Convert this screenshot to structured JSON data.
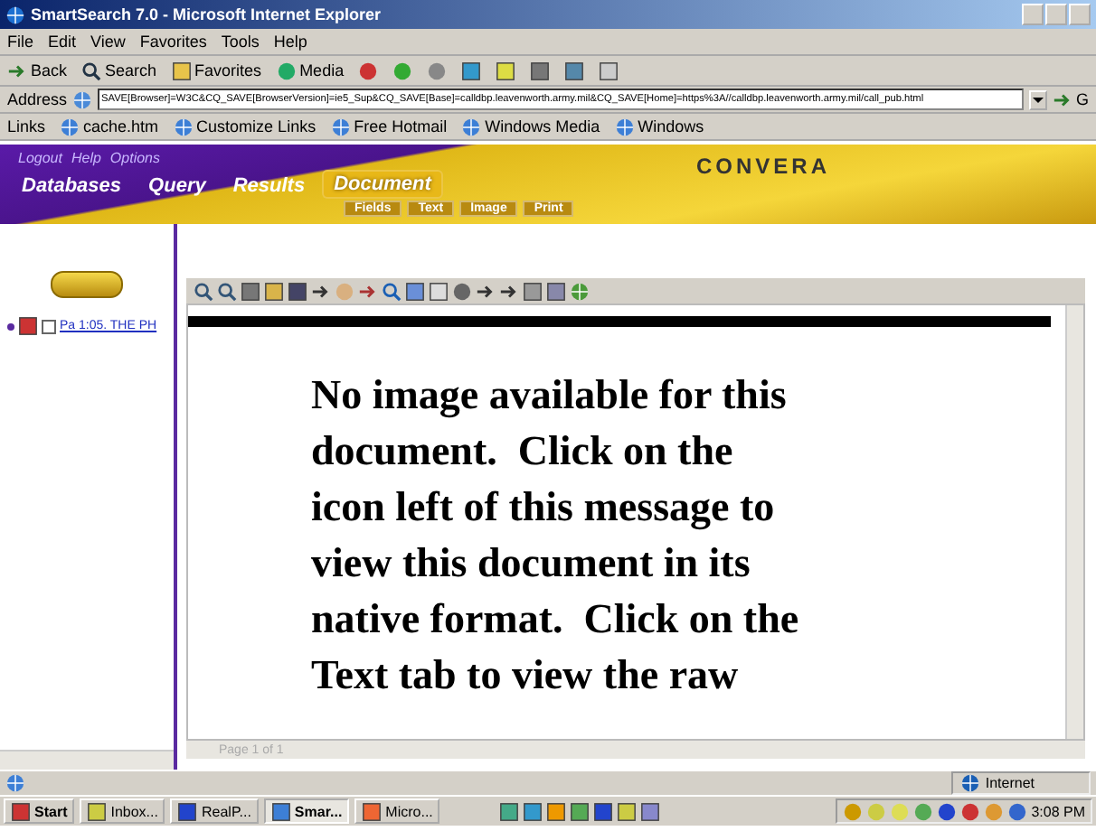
{
  "window": {
    "title": "SmartSearch 7.0 - Microsoft Internet Explorer"
  },
  "menu": [
    "File",
    "Edit",
    "View",
    "Favorites",
    "Tools",
    "Help"
  ],
  "toolbar": [
    {
      "label": "Back"
    },
    {
      "label": "Search"
    },
    {
      "label": "Favorites"
    },
    {
      "label": "Media"
    }
  ],
  "address": {
    "label": "Address",
    "value": "SAVE[Browser]=W3C&CQ_SAVE[BrowserVersion]=ie5_Sup&CQ_SAVE[Base]=calldbp.leavenworth.army.mil&CQ_SAVE[Home]=https%3A//calldbp.leavenworth.army.mil/call_pub.html",
    "go": "G"
  },
  "links": {
    "label": "Links",
    "items": [
      "cache.htm",
      "Customize Links",
      "Free Hotmail",
      "Windows Media",
      "Windows"
    ]
  },
  "banner": {
    "top_links": [
      "Logout",
      "Help",
      "Options"
    ],
    "tabs": [
      {
        "label": "Databases",
        "selected": false
      },
      {
        "label": "Query",
        "selected": false
      },
      {
        "label": "Results",
        "selected": false
      },
      {
        "label": "Document",
        "selected": true
      }
    ],
    "subtabs": [
      "Fields",
      "Text",
      "Image",
      "Print"
    ],
    "logo": "CONVERA"
  },
  "tree": [
    {
      "label": "Pa 1:05. THE PH",
      "checked": false
    }
  ],
  "viewer": {
    "message": "No image available for this\ndocument.  Click on the\nicon left of this message to\nview this document in its\nnative format.  Click on the\nText tab to view the raw",
    "page": "Page 1 of 1"
  },
  "status_bar": {
    "zone": "Internet"
  },
  "taskbar": {
    "start": "Start",
    "tasks": [
      {
        "label": "Inbox...",
        "selected": false
      },
      {
        "label": "RealP...",
        "selected": false
      },
      {
        "label": "Smar...",
        "selected": true
      },
      {
        "label": "Micro...",
        "selected": false
      }
    ],
    "clock": "3:08 PM"
  }
}
